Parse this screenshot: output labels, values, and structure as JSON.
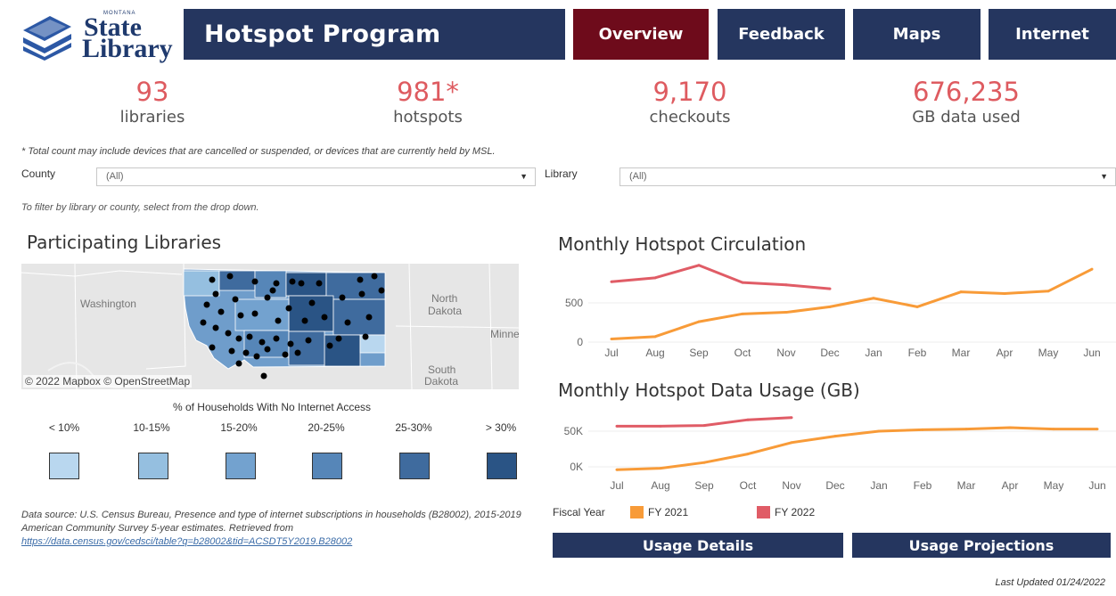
{
  "header": {
    "logo_small": "MONTANA",
    "logo_state": "State",
    "logo_library": "Library",
    "title": "Hotspot Program",
    "nav": [
      "Overview",
      "Feedback",
      "Maps",
      "Internet"
    ]
  },
  "kpis": [
    {
      "value": "93",
      "label": "libraries"
    },
    {
      "value": "981*",
      "label": "hotspots"
    },
    {
      "value": "9,170",
      "label": "checkouts"
    },
    {
      "value": "676,235",
      "label": "GB data used"
    }
  ],
  "footnote": "* Total count may include devices that are cancelled or suspended, or devices that are currently held by MSL.",
  "filters": {
    "county_label": "County",
    "county_value": "(All)",
    "library_label": "Library",
    "library_value": "(All)",
    "hint": "To filter by library or county, select from the drop down."
  },
  "map": {
    "title": "Participating Libraries",
    "labels": [
      "Washington",
      "North",
      "Dakota",
      "Minne",
      "South",
      "Dakota"
    ],
    "credit": "© 2022 Mapbox  © OpenStreetMap",
    "legend_title": "% of Households With No Internet Access",
    "legend": [
      {
        "label": "< 10%",
        "color": "#b9d7ef"
      },
      {
        "label": "10-15%",
        "color": "#95bfe0"
      },
      {
        "label": "15-20%",
        "color": "#73a2cf"
      },
      {
        "label": "20-25%",
        "color": "#5686b8"
      },
      {
        "label": "25-30%",
        "color": "#3f6b9e"
      },
      {
        "label": "> 30%",
        "color": "#2a5485"
      }
    ]
  },
  "datasource": {
    "text": "Data source: U.S. Census Bureau, Presence and type of internet subscriptions in households (B28002), 2015-2019 American Community Survey 5-year estimates. Retrieved from",
    "link": "https://data.census.gov/cedsci/table?q=b28002&tid=ACSDT5Y2019.B28002"
  },
  "chart_data": [
    {
      "type": "line",
      "title": "Monthly Hotspot Circulation",
      "categories": [
        "Jul",
        "Aug",
        "Sep",
        "Oct",
        "Nov",
        "Dec",
        "Jan",
        "Feb",
        "Mar",
        "Apr",
        "May",
        "Jun"
      ],
      "yticks": [
        "500",
        "0"
      ],
      "ylim": [
        0,
        1000
      ],
      "series": [
        {
          "name": "FY 2021",
          "color": "#f89b38",
          "values": [
            40,
            70,
            260,
            360,
            380,
            450,
            560,
            450,
            640,
            620,
            650,
            930
          ]
        },
        {
          "name": "FY 2022",
          "color": "#e05c66",
          "values": [
            770,
            820,
            980,
            760,
            730,
            680
          ]
        }
      ]
    },
    {
      "type": "line",
      "title": "Monthly Hotspot Data Usage (GB)",
      "categories": [
        "Jul",
        "Aug",
        "Sep",
        "Oct",
        "Nov",
        "Dec",
        "Jan",
        "Feb",
        "Mar",
        "Apr",
        "May",
        "Jun"
      ],
      "yticks": [
        "50K",
        "0K"
      ],
      "ylim": [
        -10000,
        80000
      ],
      "series": [
        {
          "name": "FY 2021",
          "color": "#f89b38",
          "values": [
            -4000,
            -2000,
            6000,
            18000,
            34000,
            43000,
            50000,
            52000,
            53000,
            55000,
            53000,
            53000
          ]
        },
        {
          "name": "FY 2022",
          "color": "#e05c66",
          "values": [
            57000,
            57000,
            58000,
            66000,
            69000
          ]
        }
      ]
    }
  ],
  "chart_legend": {
    "title": "Fiscal Year",
    "items": [
      {
        "label": "FY 2021",
        "color": "#f89b38"
      },
      {
        "label": "FY 2022",
        "color": "#e05c66"
      }
    ]
  },
  "buttons": {
    "usage_details": "Usage Details",
    "usage_projections": "Usage Projections"
  },
  "last_updated": "Last Updated 01/24/2022"
}
